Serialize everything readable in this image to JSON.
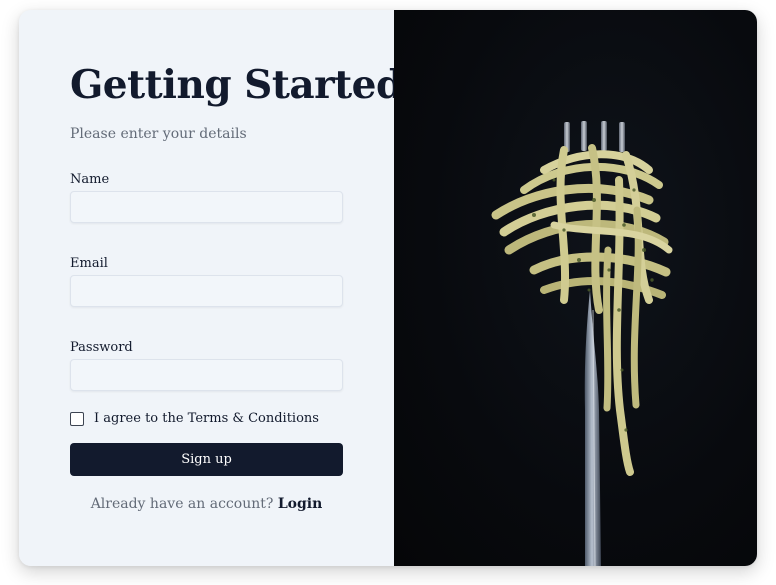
{
  "form": {
    "title": "Getting Started",
    "subtitle": "Please enter your details",
    "fields": [
      {
        "label": "Name",
        "value": "",
        "placeholder": ""
      },
      {
        "label": "Email",
        "value": "",
        "placeholder": ""
      },
      {
        "label": "Password",
        "value": "",
        "placeholder": ""
      }
    ],
    "terms_label": "I agree to the Terms & Conditions",
    "terms_checked": false,
    "submit_label": "Sign up",
    "login_prompt": "Already have an account?",
    "login_link": "Login"
  },
  "colors": {
    "panel_background": "#f0f4f9",
    "primary": "#121a2d",
    "muted_text": "#636b78",
    "image_background": "#080a0e"
  }
}
